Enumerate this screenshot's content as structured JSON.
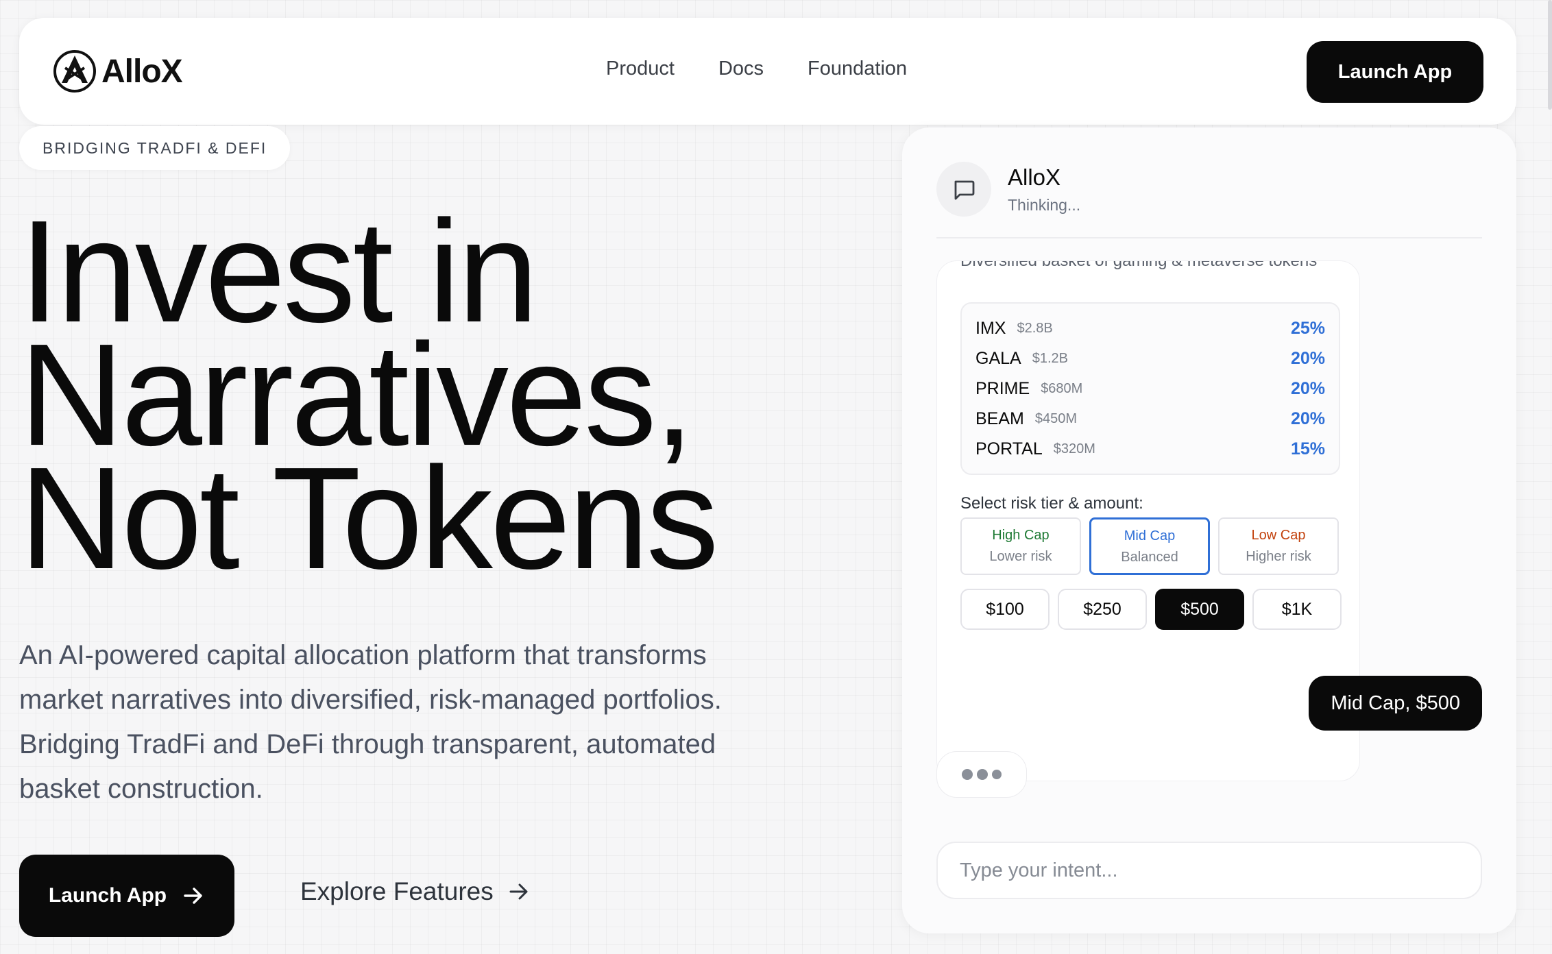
{
  "nav": {
    "brand": "AlloX",
    "links": [
      "Product",
      "Docs",
      "Foundation"
    ],
    "cta": "Launch App"
  },
  "hero": {
    "badge": "BRIDGING TRADFI & DEFI",
    "headline": [
      "Invest in",
      "Narratives,",
      "Not Tokens"
    ],
    "subtitle": "An AI-powered capital allocation platform that transforms market narratives into diversified, risk-managed portfolios. Bridging TradFi and DeFi through transparent, automated basket construction.",
    "cta_primary": "Launch App",
    "cta_secondary": "Explore Features"
  },
  "chat": {
    "name": "AlloX",
    "status": "Thinking...",
    "basket_desc": "Diversified basket of gaming & metaverse tokens",
    "allocations": [
      {
        "symbol": "IMX",
        "cap": "$2.8B",
        "pct": "25%"
      },
      {
        "symbol": "GALA",
        "cap": "$1.2B",
        "pct": "20%"
      },
      {
        "symbol": "PRIME",
        "cap": "$680M",
        "pct": "20%"
      },
      {
        "symbol": "BEAM",
        "cap": "$450M",
        "pct": "20%"
      },
      {
        "symbol": "PORTAL",
        "cap": "$320M",
        "pct": "15%"
      }
    ],
    "risk_label": "Select risk tier & amount:",
    "tiers": [
      {
        "title": "High Cap",
        "desc": "Lower risk",
        "color": "#1e7a34",
        "selected": false
      },
      {
        "title": "Mid Cap",
        "desc": "Balanced",
        "color": "#2f6fd6",
        "selected": true
      },
      {
        "title": "Low Cap",
        "desc": "Higher risk",
        "color": "#c2410c",
        "selected": false
      }
    ],
    "amounts": [
      {
        "label": "$100",
        "selected": false
      },
      {
        "label": "$250",
        "selected": false
      },
      {
        "label": "$500",
        "selected": true
      },
      {
        "label": "$1K",
        "selected": false
      }
    ],
    "user_message": "Mid Cap, $500",
    "input_placeholder": "Type your intent..."
  },
  "icons": {
    "logo": "allox-logo-icon",
    "chat": "chat-bubble-icon",
    "arrow": "arrow-right-icon"
  },
  "colors": {
    "accent_blue": "#2f6fd6",
    "high_cap_green": "#1e7a34",
    "low_cap_orange": "#c2410c",
    "button_black": "#0a0a0a"
  }
}
